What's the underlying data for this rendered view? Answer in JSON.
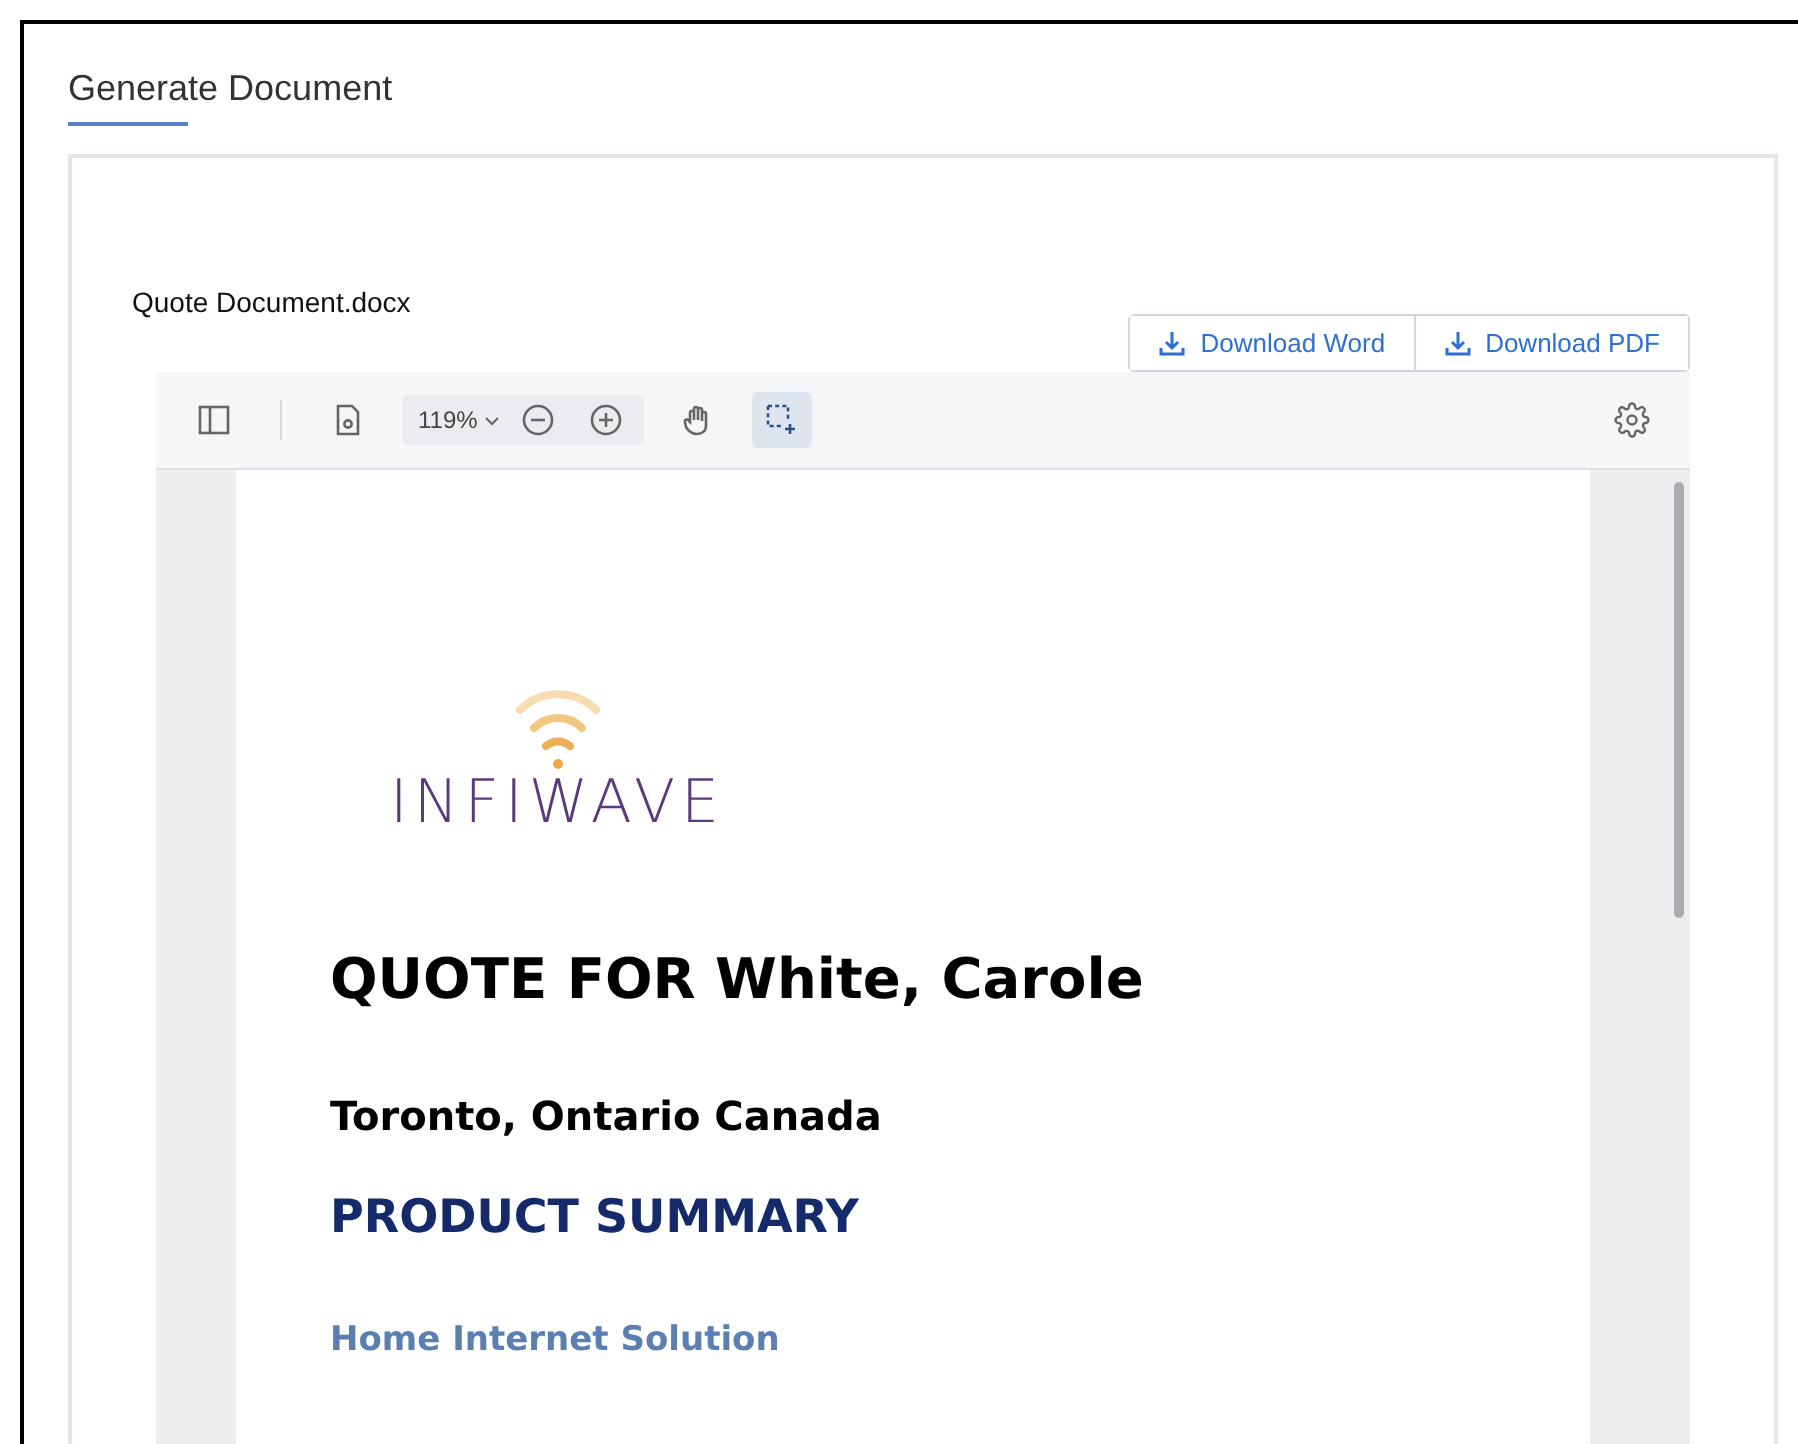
{
  "page": {
    "title": "Generate Document"
  },
  "document": {
    "file_name": "Quote Document.docx",
    "downloads": [
      {
        "label": "Download Word"
      },
      {
        "label": "Download PDF"
      }
    ],
    "toolbar": {
      "tools": [
        {
          "kind": "sidebar",
          "selected": false
        },
        {
          "kind": "page",
          "selected": false
        }
      ],
      "zoom": "119%",
      "zoom_tools": [
        {
          "kind": "zoom-out"
        },
        {
          "kind": "zoom-in"
        }
      ],
      "mode_tools": [
        {
          "kind": "hand",
          "selected": false
        },
        {
          "kind": "select",
          "selected": true
        }
      ]
    },
    "content": {
      "logo": "INFIWAVE",
      "title": "QUOTE FOR White, Carole",
      "location": "Toronto, Ontario Canada",
      "section": "PRODUCT SUMMARY",
      "subsection": "Home Internet Solution"
    }
  }
}
